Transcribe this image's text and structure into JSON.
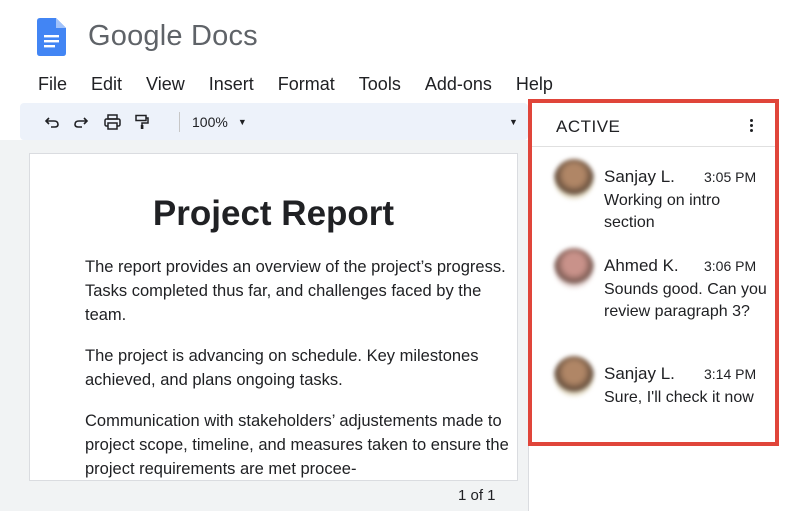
{
  "app": {
    "title": "Google Docs",
    "icon": "google-docs-icon",
    "brand_color": "#4285f4"
  },
  "menu": [
    "File",
    "Edit",
    "View",
    "Insert",
    "Format",
    "Tools",
    "Add-ons",
    "Help"
  ],
  "toolbar": {
    "icons": [
      "undo-icon",
      "redo-icon",
      "print-icon",
      "paint-format-icon"
    ],
    "zoom": "100%",
    "background_color": "#edf2fa"
  },
  "document": {
    "title": "Project Report",
    "paragraphs": [
      "The report provides an overview of the project’s progress. Tasks completed thus far, and challenges faced by the team.",
      "The project is advancing on schedule. Key milestones achieved, and plans ongoing tasks.",
      "Communication with stakeholders’ adjustements made to project scope, timeline, and measures taken to ensure the project requirements are met procee-"
    ],
    "page_indicator": "1 of 1"
  },
  "active_panel": {
    "title": "ACTIVE",
    "highlight_color": "#e0453a",
    "messages": [
      {
        "name": "Sanjay L.",
        "time": "3:05 PM",
        "text": "Working on intro section"
      },
      {
        "name": "Ahmed K.",
        "time": "3:06 PM",
        "text": "Sounds good. Can you review paragraph 3?"
      },
      {
        "name": "Sanjay L.",
        "time": "3:14 PM",
        "text": "Sure, I'll check it now"
      }
    ]
  }
}
